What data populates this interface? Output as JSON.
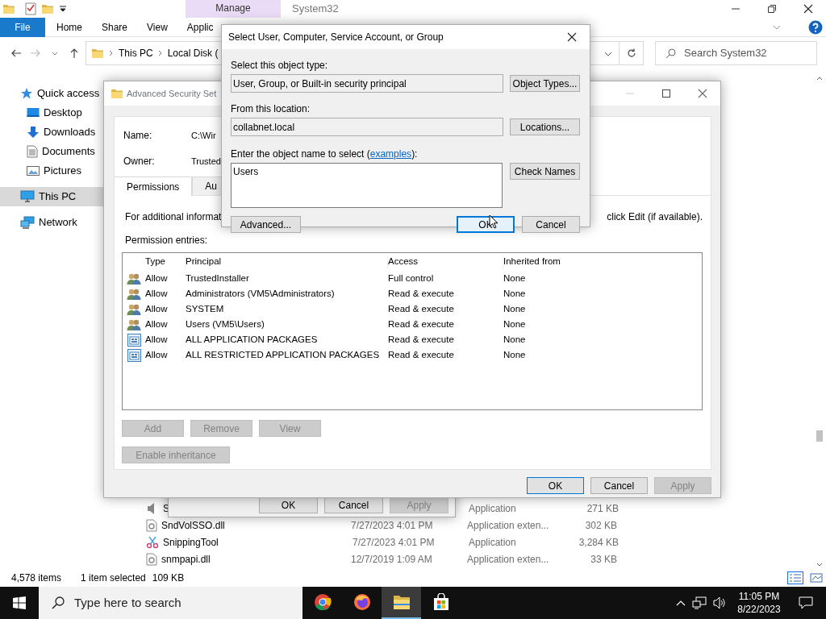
{
  "explorer": {
    "title": "System32",
    "context_tab": "Manage",
    "ribbon_tabs": [
      {
        "label": "File",
        "kind": "file"
      },
      {
        "label": "Home",
        "kind": "tab"
      },
      {
        "label": "Share",
        "kind": "tab"
      },
      {
        "label": "View",
        "kind": "tab"
      },
      {
        "label": "Applic",
        "kind": "tab"
      }
    ],
    "breadcrumb": [
      "This PC",
      "Local Disk ("
    ],
    "search": {
      "placeholder": "Search System32"
    },
    "nav": [
      {
        "label": "Quick access",
        "kind": "star",
        "selected": false,
        "children": [
          {
            "label": "Desktop",
            "kind": "desktop",
            "selected": false
          },
          {
            "label": "Downloads",
            "kind": "download",
            "selected": false
          },
          {
            "label": "Documents",
            "kind": "document",
            "selected": false
          },
          {
            "label": "Pictures",
            "kind": "pictures",
            "selected": false
          }
        ]
      },
      {
        "label": "This PC",
        "kind": "pc",
        "selected": true
      },
      {
        "label": "Network",
        "kind": "network",
        "selected": false
      }
    ],
    "files": [
      {
        "kind": "speaker",
        "name": "S",
        "type": "Application",
        "size": "271 KB"
      },
      {
        "kind": "dll",
        "name": "SndVolSSO.dll",
        "date": "7/27/2023 4:01 PM",
        "type": "Application exten...",
        "size": "302 KB"
      },
      {
        "kind": "scissors",
        "name": "SnippingTool",
        "date": "7/27/2023 4:01 PM",
        "type": "Application",
        "size": "3,284 KB"
      },
      {
        "kind": "dll",
        "name": "snmpapi.dll",
        "date": "12/7/2019 1:09 AM",
        "type": "Application exten...",
        "size": "33 KB"
      }
    ],
    "status": {
      "count": "4,578 items",
      "selection": "1 item selected",
      "size": "109 KB"
    }
  },
  "properties_dialog": {
    "buttons": [
      {
        "label": "OK",
        "disabled": false
      },
      {
        "label": "Cancel",
        "disabled": false
      },
      {
        "label": "Apply",
        "disabled": true
      }
    ]
  },
  "advanced_security": {
    "title": "Advanced Security Set",
    "name_label": "Name:",
    "name_value": "C:\\Wir",
    "owner_label": "Owner:",
    "owner_value": "Trusted",
    "tabs": [
      {
        "label": "Permissions",
        "selected": true
      },
      {
        "label": "Au",
        "selected": false
      }
    ],
    "info_left": "For additional informat",
    "info_right": "click Edit (if available).",
    "entries_label": "Permission entries:",
    "columns": [
      "Type",
      "Principal",
      "Access",
      "Inherited from"
    ],
    "rows": [
      {
        "kind": "user",
        "type": "Allow",
        "principal": "TrustedInstaller",
        "access": "Full control",
        "inherited": "None"
      },
      {
        "kind": "user",
        "type": "Allow",
        "principal": "Administrators (VM5\\Administrators)",
        "access": "Read & execute",
        "inherited": "None"
      },
      {
        "kind": "user",
        "type": "Allow",
        "principal": "SYSTEM",
        "access": "Read & execute",
        "inherited": "None"
      },
      {
        "kind": "user",
        "type": "Allow",
        "principal": "Users (VM5\\Users)",
        "access": "Read & execute",
        "inherited": "None"
      },
      {
        "kind": "package",
        "type": "Allow",
        "principal": "ALL APPLICATION PACKAGES",
        "access": "Read & execute",
        "inherited": "None"
      },
      {
        "kind": "package",
        "type": "Allow",
        "principal": "ALL RESTRICTED APPLICATION PACKAGES",
        "access": "Read & execute",
        "inherited": "None"
      }
    ],
    "entry_buttons": [
      {
        "label": "Add",
        "disabled": true
      },
      {
        "label": "Remove",
        "disabled": true
      },
      {
        "label": "View",
        "disabled": true
      }
    ],
    "inheritance_button": {
      "label": "Enable inheritance",
      "disabled": true
    },
    "footer_buttons": [
      {
        "label": "OK",
        "default": true,
        "disabled": false
      },
      {
        "label": "Cancel",
        "default": false,
        "disabled": false
      },
      {
        "label": "Apply",
        "default": false,
        "disabled": true
      }
    ]
  },
  "select_dialog": {
    "title": "Select User, Computer, Service Account, or Group",
    "type_label": "Select this object type:",
    "type_value": "User, Group, or Built-in security principal",
    "type_button": "Object Types...",
    "location_label": "From this location:",
    "location_value": "collabnet.local",
    "location_button": "Locations...",
    "name_label_before": "Enter the object name to select (",
    "name_link": "examples",
    "name_label_after": "):",
    "name_value": "Users",
    "check_button": "Check Names",
    "advanced_button": "Advanced...",
    "footer_buttons": [
      {
        "label": "OK",
        "default": true
      },
      {
        "label": "Cancel",
        "default": false
      }
    ]
  },
  "taskbar": {
    "search_placeholder": "Type here to search",
    "apps": [
      {
        "kind": "chrome",
        "active": false
      },
      {
        "kind": "firefox",
        "active": false
      },
      {
        "kind": "folder",
        "active": true
      },
      {
        "kind": "store",
        "active": false
      }
    ],
    "time": "11:05 PM",
    "date": "8/22/2023"
  }
}
